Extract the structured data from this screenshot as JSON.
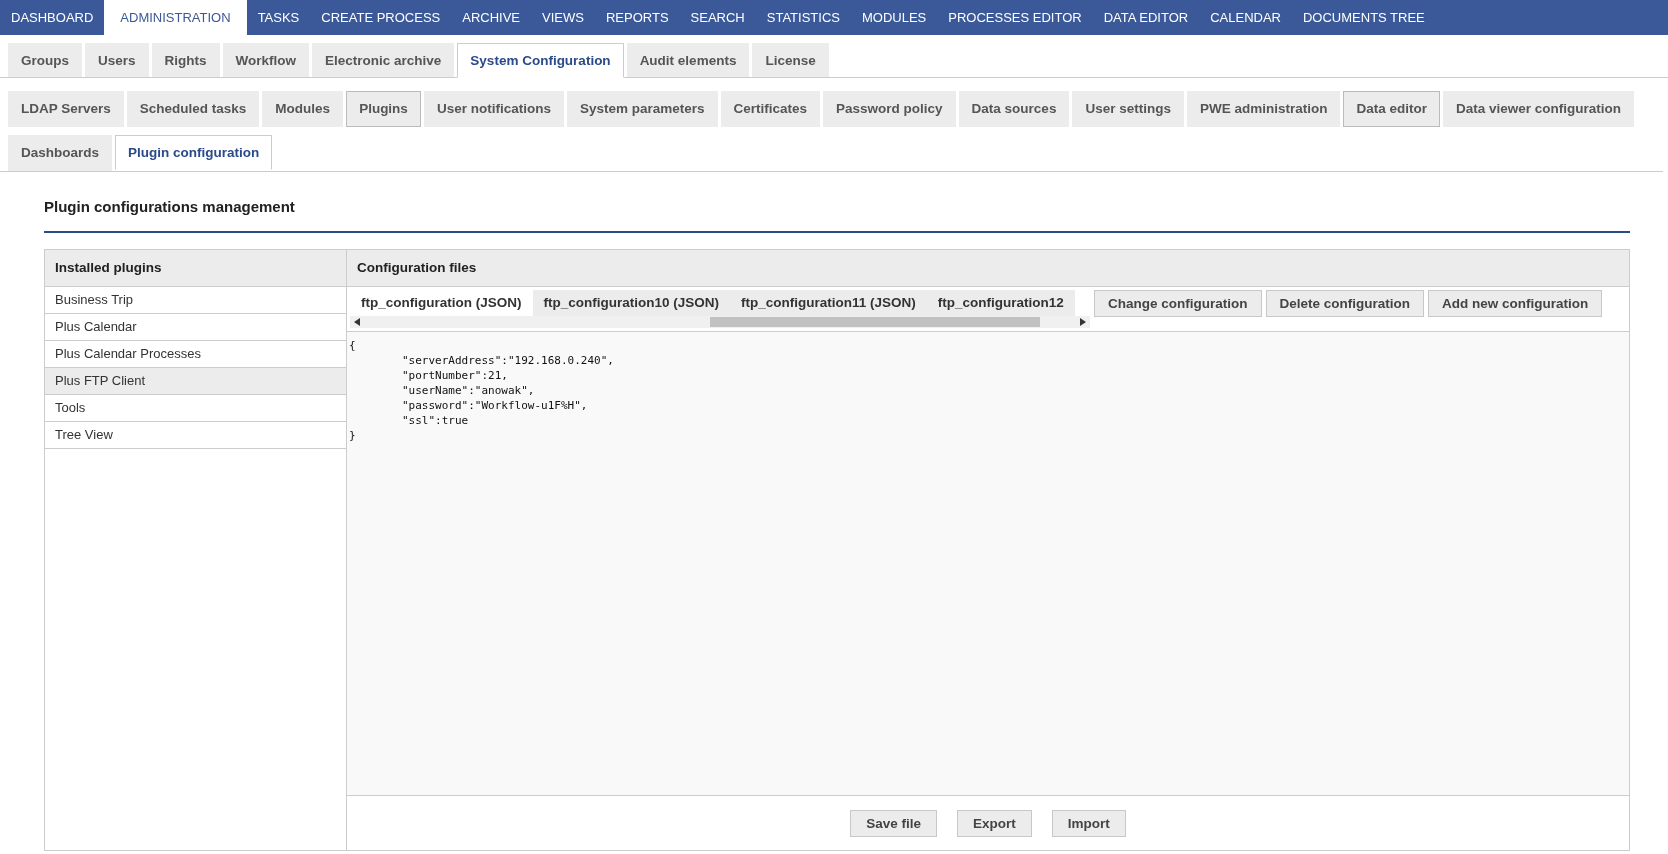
{
  "top_nav": [
    {
      "label": "DASHBOARD",
      "selected": false
    },
    {
      "label": "ADMINISTRATION",
      "selected": true
    },
    {
      "label": "TASKS",
      "selected": false
    },
    {
      "label": "CREATE PROCESS",
      "selected": false
    },
    {
      "label": "ARCHIVE",
      "selected": false
    },
    {
      "label": "VIEWS",
      "selected": false
    },
    {
      "label": "REPORTS",
      "selected": false
    },
    {
      "label": "SEARCH",
      "selected": false
    },
    {
      "label": "STATISTICS",
      "selected": false
    },
    {
      "label": "MODULES",
      "selected": false
    },
    {
      "label": "PROCESSES EDITOR",
      "selected": false
    },
    {
      "label": "DATA EDITOR",
      "selected": false
    },
    {
      "label": "CALENDAR",
      "selected": false
    },
    {
      "label": "DOCUMENTS TREE",
      "selected": false
    }
  ],
  "admin_tabs": [
    {
      "label": "Groups",
      "selected": false
    },
    {
      "label": "Users",
      "selected": false
    },
    {
      "label": "Rights",
      "selected": false
    },
    {
      "label": "Workflow",
      "selected": false
    },
    {
      "label": "Electronic archive",
      "selected": false
    },
    {
      "label": "System Configuration",
      "selected": true
    },
    {
      "label": "Audit elements",
      "selected": false
    },
    {
      "label": "License",
      "selected": false
    }
  ],
  "config_tabs": [
    {
      "label": "LDAP Servers",
      "selected": false,
      "outlined": false
    },
    {
      "label": "Scheduled tasks",
      "selected": false,
      "outlined": false
    },
    {
      "label": "Modules",
      "selected": false,
      "outlined": false
    },
    {
      "label": "Plugins",
      "selected": false,
      "outlined": true
    },
    {
      "label": "User notifications",
      "selected": false,
      "outlined": false
    },
    {
      "label": "System parameters",
      "selected": false,
      "outlined": false
    },
    {
      "label": "Certificates",
      "selected": false,
      "outlined": false
    },
    {
      "label": "Password policy",
      "selected": false,
      "outlined": false
    },
    {
      "label": "Data sources",
      "selected": false,
      "outlined": false
    },
    {
      "label": "User settings",
      "selected": false,
      "outlined": false
    },
    {
      "label": "PWE administration",
      "selected": false,
      "outlined": false
    },
    {
      "label": "Data editor",
      "selected": false,
      "outlined": true
    },
    {
      "label": "Data viewer configuration",
      "selected": false,
      "outlined": false
    },
    {
      "label": "Dashboards",
      "selected": false,
      "outlined": false
    },
    {
      "label": "Plugin configuration",
      "selected": true,
      "outlined": false
    }
  ],
  "page_title": "Plugin configurations management",
  "plugins": {
    "title": "Installed plugins",
    "items": [
      {
        "label": "Business Trip",
        "selected": false
      },
      {
        "label": "Plus Calendar",
        "selected": false
      },
      {
        "label": "Plus Calendar Processes",
        "selected": false
      },
      {
        "label": "Plus FTP Client",
        "selected": true
      },
      {
        "label": "Tools",
        "selected": false
      },
      {
        "label": "Tree View",
        "selected": false
      }
    ]
  },
  "config_files": {
    "title": "Configuration files",
    "tabs": [
      {
        "label": "ftp_configuration (JSON)",
        "selected": true
      },
      {
        "label": "ftp_configuration10 (JSON)",
        "selected": false
      },
      {
        "label": "ftp_configuration11 (JSON)",
        "selected": false
      },
      {
        "label": "ftp_configuration12",
        "selected": false
      }
    ],
    "actions": [
      "Change configuration",
      "Delete configuration",
      "Add new configuration"
    ],
    "editor_value": "{\n\t\"serverAddress\":\"192.168.0.240\",\n\t\"portNumber\":21,\n\t\"userName\":\"anowak\",\n\t\"password\":\"Workflow-u1F%H\",\n\t\"ssl\":true\n}",
    "footer_buttons": [
      "Save file",
      "Export",
      "Import"
    ]
  }
}
